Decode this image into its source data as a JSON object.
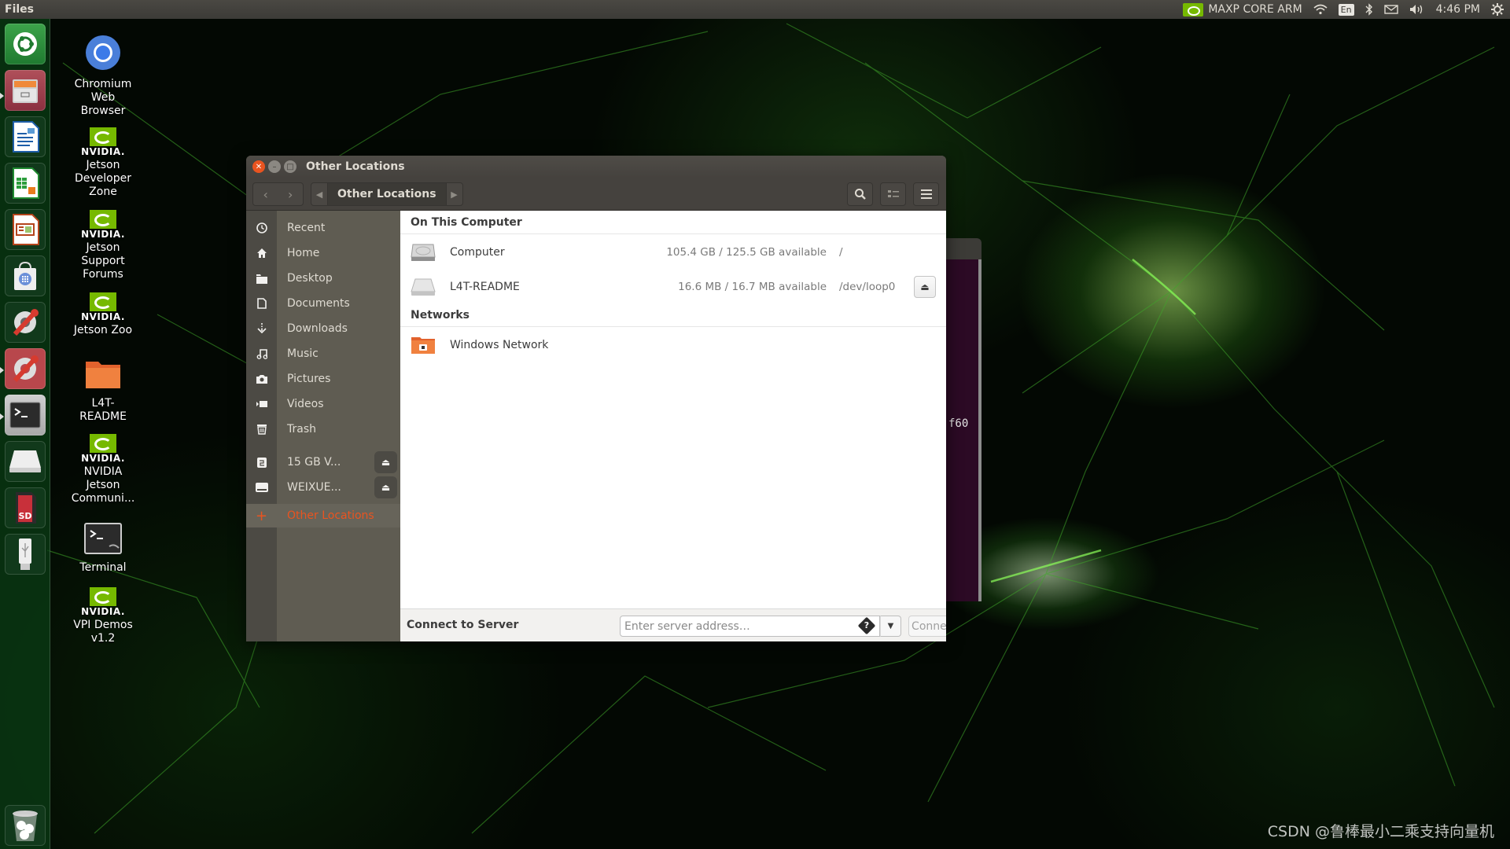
{
  "top_panel": {
    "app_name": "Files",
    "device_name": "MAXP CORE ARM",
    "keyboard_layout": "En",
    "clock": "4:46 PM",
    "tray_icons": [
      "nvidia-icon",
      "wifi-icon",
      "keyboard-layout-icon",
      "bluetooth-icon",
      "mail-icon",
      "volume-icon",
      "power-gear-icon"
    ]
  },
  "launcher": {
    "items": [
      {
        "name": "ubuntu-dash",
        "icon": "ubuntu-logo-icon"
      },
      {
        "name": "files",
        "icon": "file-cabinet-icon"
      },
      {
        "name": "libreoffice-writer",
        "icon": "writer-document-icon"
      },
      {
        "name": "libreoffice-calc",
        "icon": "calc-spreadsheet-icon"
      },
      {
        "name": "libreoffice-impress",
        "icon": "impress-presentation-icon"
      },
      {
        "name": "software-center",
        "icon": "shopping-bag-icon"
      },
      {
        "name": "system-settings",
        "icon": "settings-wrench-icon"
      },
      {
        "name": "system-settings-2",
        "icon": "settings-wrench-red-icon"
      },
      {
        "name": "terminal",
        "icon": "terminal-icon"
      },
      {
        "name": "drive",
        "icon": "drive-icon"
      },
      {
        "name": "sd-card",
        "icon": "sd-card-icon"
      },
      {
        "name": "usb-drive",
        "icon": "usb-icon"
      },
      {
        "name": "trash",
        "icon": "trash-icon"
      }
    ]
  },
  "desktop_icons": [
    {
      "label_lines": [
        "Chromium",
        "Web",
        "Browser"
      ],
      "icon": "chromium-icon"
    },
    {
      "label_lines": [
        "Jetson",
        "Developer",
        "Zone"
      ],
      "icon": "nvidia-icon",
      "brand": "NVIDIA."
    },
    {
      "label_lines": [
        "Jetson",
        "Support",
        "Forums"
      ],
      "icon": "nvidia-icon",
      "brand": "NVIDIA."
    },
    {
      "label_lines": [
        "Jetson Zoo"
      ],
      "icon": "nvidia-icon",
      "brand": "NVIDIA."
    },
    {
      "label_lines": [
        "L4T-",
        "README"
      ],
      "icon": "folder-icon"
    },
    {
      "label_lines": [
        "NVIDIA",
        "Jetson",
        "Communi..."
      ],
      "icon": "nvidia-icon",
      "brand": "NVIDIA."
    },
    {
      "label_lines": [
        "Terminal"
      ],
      "icon": "terminal-icon"
    },
    {
      "label_lines": [
        "VPI Demos",
        "v1.2"
      ],
      "icon": "nvidia-icon",
      "brand": "NVIDIA."
    }
  ],
  "background_terminal": {
    "visible_text": "f60"
  },
  "window": {
    "title": "Other Locations",
    "path_bar": {
      "current": "Other Locations"
    },
    "toolbar": {
      "search": "search-icon",
      "view": "list-view-icon",
      "menu": "hamburger-menu-icon"
    },
    "sidebar": {
      "places": [
        {
          "label": "Recent",
          "icon": "clock-icon"
        },
        {
          "label": "Home",
          "icon": "home-icon"
        },
        {
          "label": "Desktop",
          "icon": "folder-icon"
        },
        {
          "label": "Documents",
          "icon": "document-icon"
        },
        {
          "label": "Downloads",
          "icon": "download-icon"
        },
        {
          "label": "Music",
          "icon": "music-icon"
        },
        {
          "label": "Pictures",
          "icon": "camera-icon"
        },
        {
          "label": "Videos",
          "icon": "video-icon"
        },
        {
          "label": "Trash",
          "icon": "trash-icon"
        }
      ],
      "devices": [
        {
          "label": "15 GB V...",
          "icon": "drive-icon",
          "ejectable": true
        },
        {
          "label": "WEIXUE...",
          "icon": "removable-drive-icon",
          "ejectable": true
        }
      ],
      "other_locations": {
        "label": "Other Locations",
        "icon": "plus-icon",
        "active": true
      }
    },
    "content": {
      "sections": [
        {
          "header": "On This Computer",
          "items": [
            {
              "name": "Computer",
              "usage": "105.4 GB / 125.5 GB available",
              "path": "/",
              "icon": "hard-disk-icon",
              "ejectable": false
            },
            {
              "name": "L4T-README",
              "usage": "16.6 MB / 16.7 MB available",
              "path": "/dev/loop0",
              "icon": "drive-icon",
              "ejectable": true
            }
          ]
        },
        {
          "header": "Networks",
          "items": [
            {
              "name": "Windows Network",
              "icon": "network-folder-icon"
            }
          ]
        }
      ]
    },
    "connect_bar": {
      "label": "Connect to Server",
      "input_value": "",
      "input_placeholder": "Enter server address…",
      "button_label": "Connect"
    }
  },
  "watermark": "CSDN @鲁棒最小二乘支持向量机",
  "colors": {
    "accent": "#e95420",
    "nvidia_green": "#76b900",
    "panel": "#3c3b37",
    "sidebar": "#5f5c52",
    "terminal_bg": "#2c0a25"
  }
}
